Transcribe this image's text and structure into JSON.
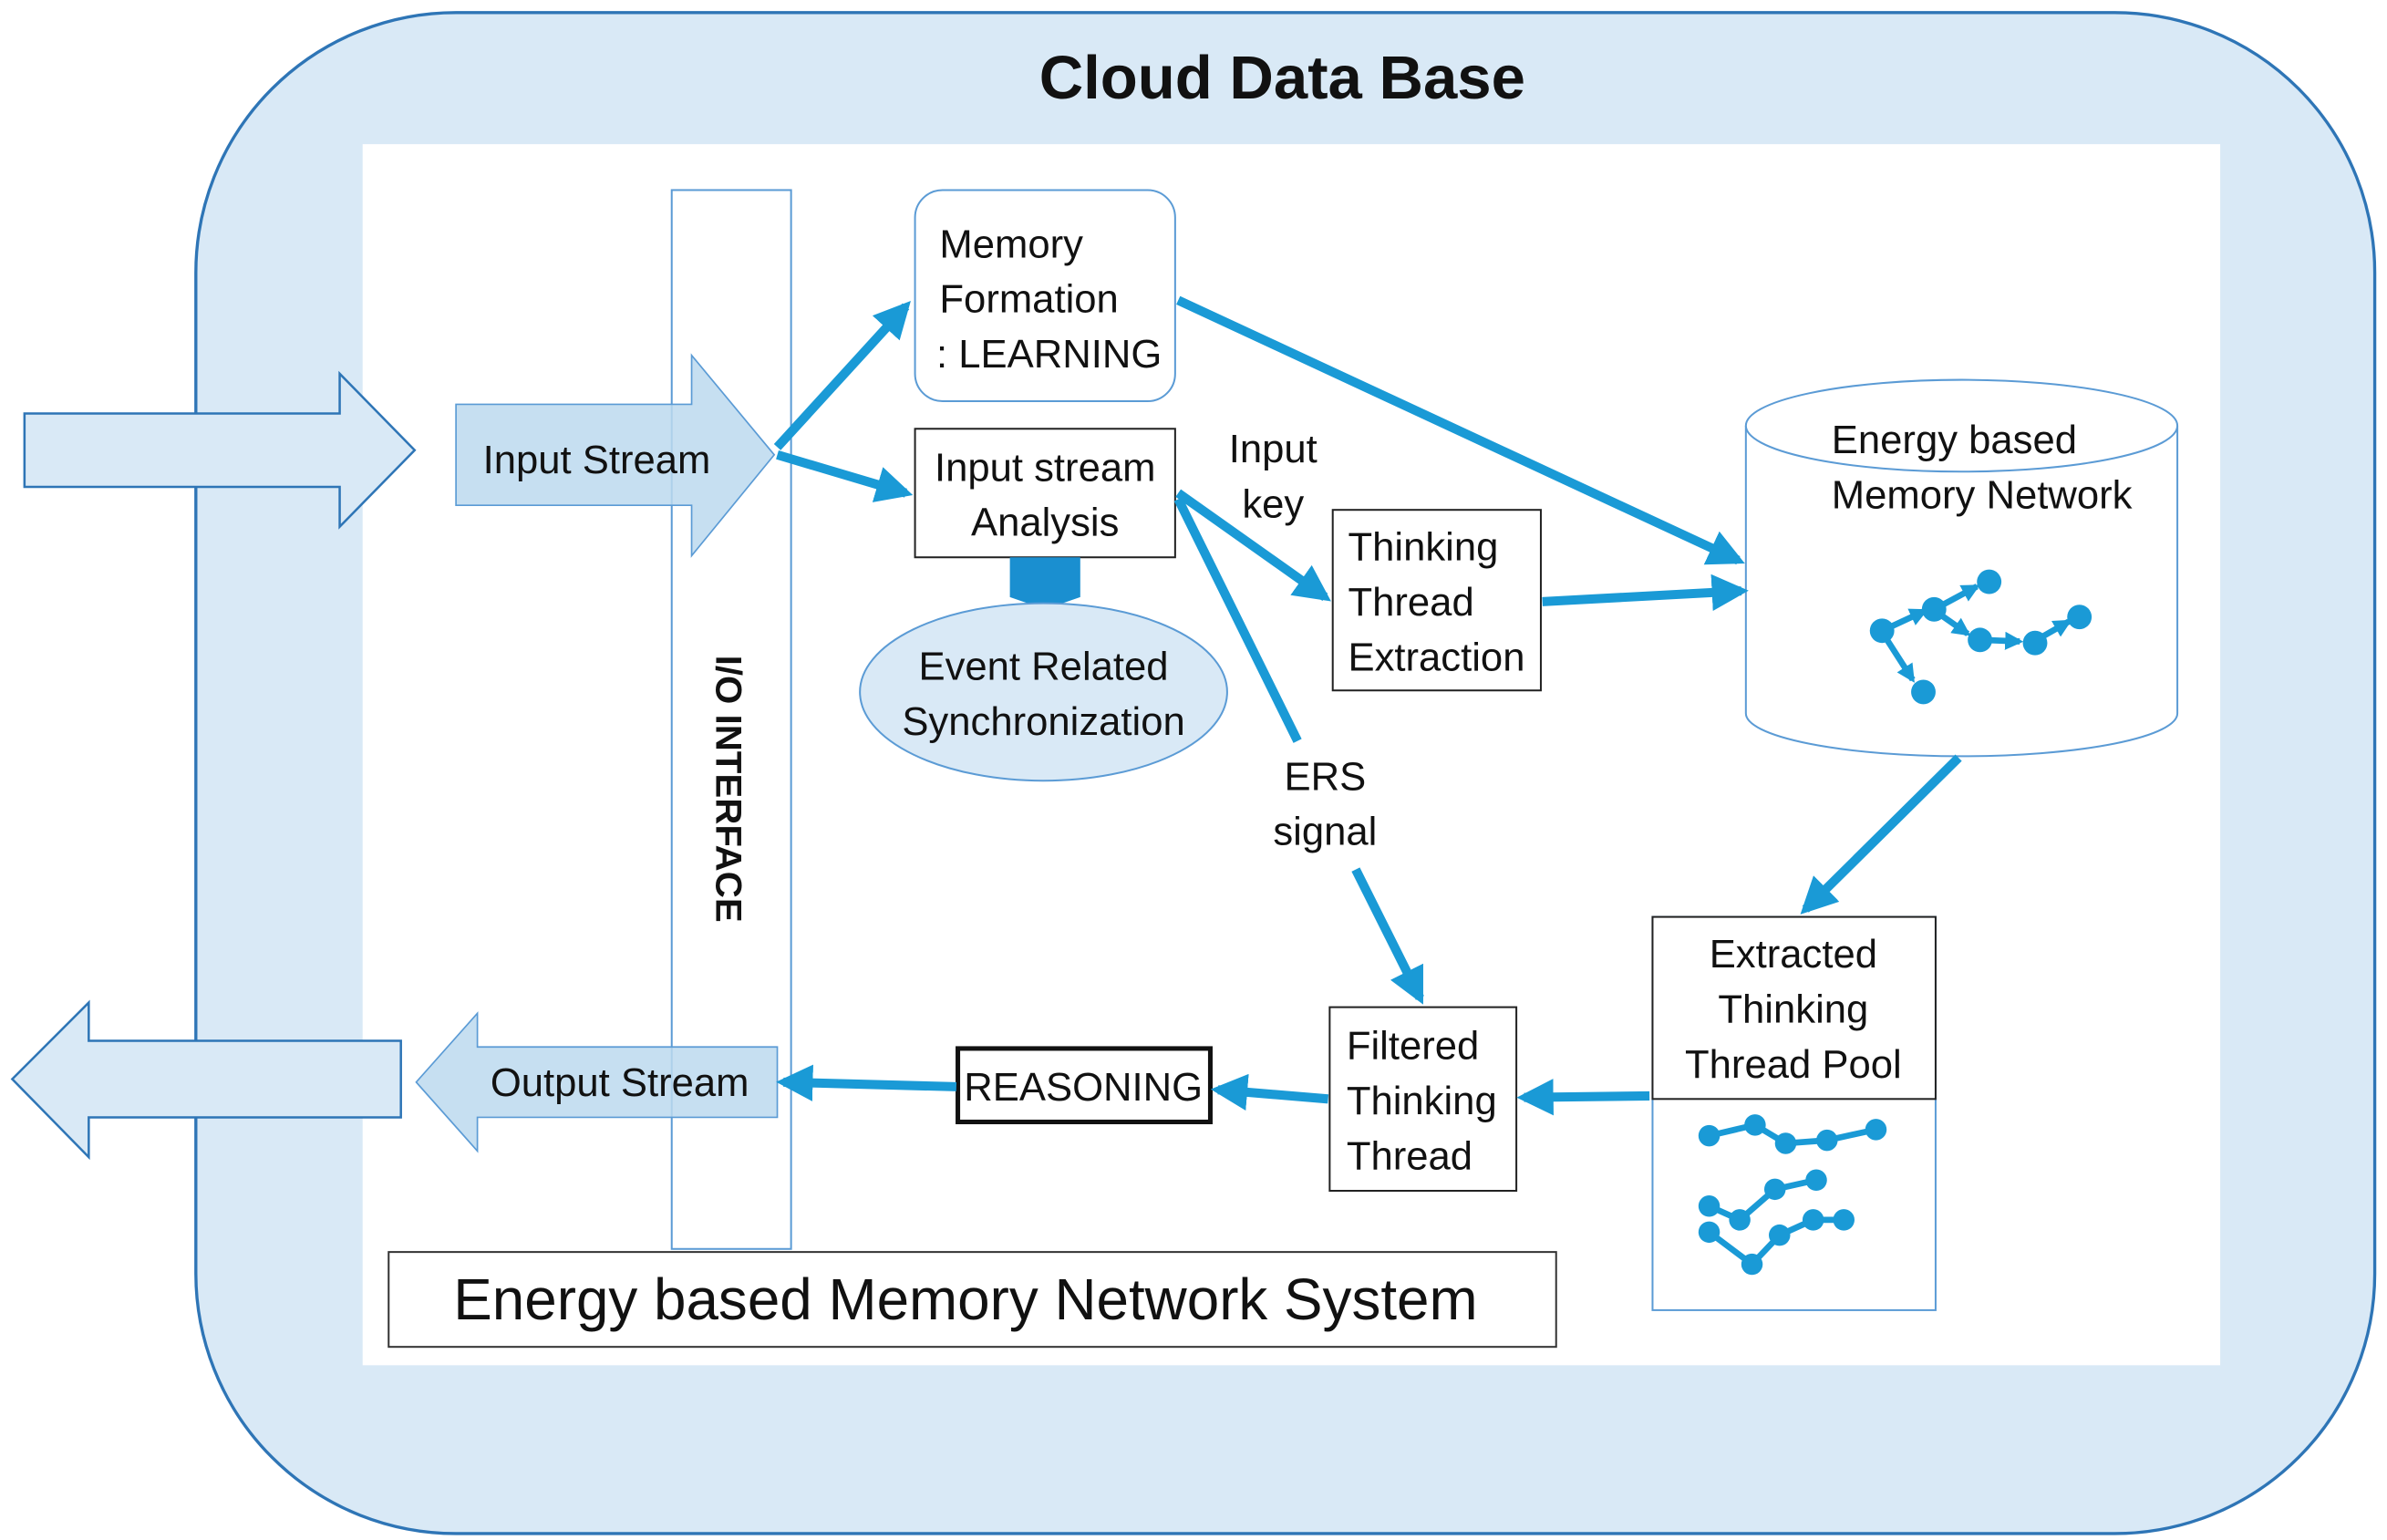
{
  "diagram": {
    "outer_title": "Cloud Data Base",
    "system_label": "Energy based Memory Network System",
    "io_interface": "I/O INTERFACE",
    "input_stream": "Input Stream",
    "output_stream": "Output Stream",
    "memory_formation": [
      "Memory",
      "Formation",
      ": LEARNING"
    ],
    "input_analysis": [
      "Input stream",
      "Analysis"
    ],
    "ers_sync": [
      "Event Related",
      "Synchronization"
    ],
    "input_key": [
      "Input",
      "key"
    ],
    "thread_extraction": [
      "Thinking",
      "Thread",
      "Extraction"
    ],
    "memory_network": [
      "Energy based",
      "Memory Network"
    ],
    "ers_signal": [
      "ERS",
      "signal"
    ],
    "thread_pool": [
      "Extracted",
      "Thinking",
      "Thread Pool"
    ],
    "filtered_thread": [
      "Filtered",
      "Thinking",
      "Thread"
    ],
    "reasoning": "REASONING"
  },
  "colors": {
    "accent": "#1a9ad6",
    "panel_fill": "#d9e9f6",
    "panel_stroke": "#2e75b6"
  }
}
